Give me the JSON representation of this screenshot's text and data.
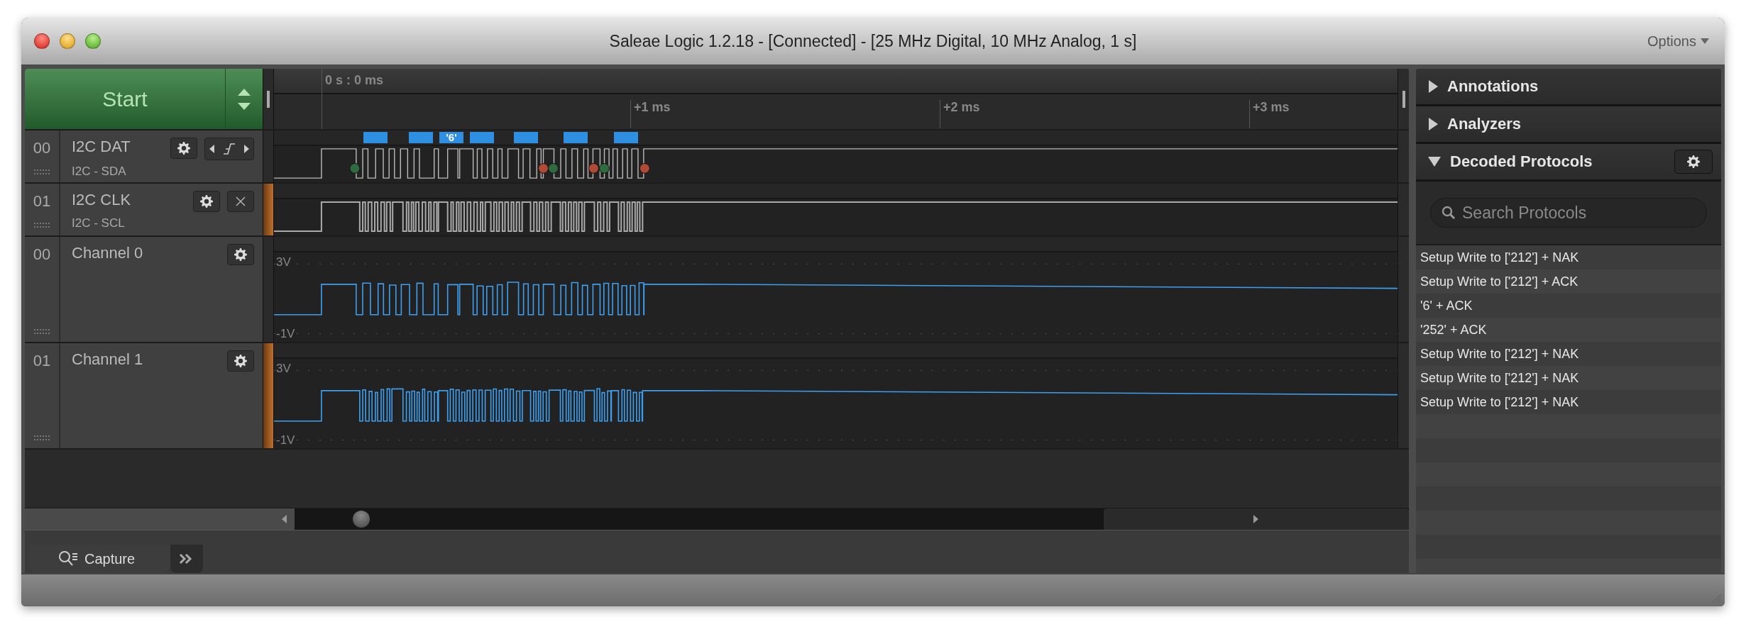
{
  "window": {
    "title": "Saleae Logic 1.2.18 - [Connected] - [25 MHz Digital, 10 MHz Analog, 1 s]",
    "options": "Options"
  },
  "start_button": {
    "label": "Start"
  },
  "timeline": {
    "origin": "0 s : 0 ms",
    "ticks": [
      "+1 ms",
      "+2 ms",
      "+3 ms"
    ]
  },
  "channels": [
    {
      "number": "00",
      "name": "I2C DAT",
      "protocol": "I2C - SDA",
      "kind": "digital",
      "edge_nav": true,
      "closable": false,
      "accent": false,
      "decoded_label": "'6'"
    },
    {
      "number": "01",
      "name": "I2C CLK",
      "protocol": "I2C - SCL",
      "kind": "digital",
      "edge_nav": false,
      "closable": true,
      "accent": true
    },
    {
      "number": "00",
      "name": "Channel 0",
      "kind": "analog",
      "accent": false,
      "axis_max": "3V",
      "axis_min": "-1V"
    },
    {
      "number": "01",
      "name": "Channel 1",
      "kind": "analog",
      "accent": true,
      "axis_max": "3V",
      "axis_min": "-1V"
    }
  ],
  "sections": [
    {
      "title": "Annotations",
      "expanded": false,
      "has_settings": false
    },
    {
      "title": "Analyzers",
      "expanded": false,
      "has_settings": false
    },
    {
      "title": "Decoded Protocols",
      "expanded": true,
      "has_settings": true
    }
  ],
  "search": {
    "placeholder": "Search Protocols"
  },
  "decoded": [
    "Setup Write to ['212'] + NAK",
    "Setup Write to ['212'] + ACK",
    "'6' + ACK",
    "'252' + ACK",
    "Setup Write to ['212'] + NAK",
    "Setup Write to ['212'] + NAK",
    "Setup Write to ['212'] + NAK"
  ],
  "capture_tab": "Capture"
}
